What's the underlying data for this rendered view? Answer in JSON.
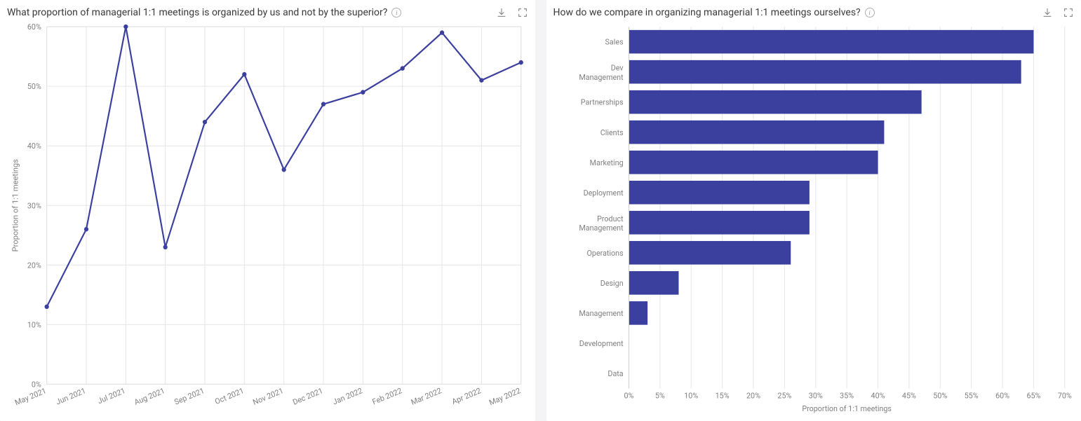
{
  "colors": {
    "series": "#3b3f9e"
  },
  "left_panel": {
    "title": "What proportion of managerial 1:1 meetings is organized by us and not by the superior?",
    "y_axis_label": "Proportion of 1:1 meetings",
    "tooltip": "i"
  },
  "right_panel": {
    "title": "How do we compare in organizing managerial 1:1 meetings ourselves?",
    "x_axis_label": "Proportion of 1:1 meetings",
    "tooltip": "i"
  },
  "chart_data": [
    {
      "id": "proportion_over_time",
      "type": "line",
      "categories": [
        "May 2021",
        "Jun 2021",
        "Jul 2021",
        "Aug 2021",
        "Sep 2021",
        "Oct 2021",
        "Nov 2021",
        "Dec 2021",
        "Jan 2022",
        "Feb 2022",
        "Mar 2022",
        "Apr 2022",
        "May 2022"
      ],
      "values": [
        13,
        26,
        60,
        23,
        44,
        52,
        36,
        47,
        49,
        53,
        59,
        51,
        54
      ],
      "title": "What proportion of managerial 1:1 meetings is organized by us and not by the superior?",
      "xlabel": "",
      "ylabel": "Proportion of 1:1 meetings",
      "ylim": [
        0,
        60
      ],
      "yticks": [
        0,
        10,
        20,
        30,
        40,
        50,
        60
      ],
      "y_suffix": "%"
    },
    {
      "id": "proportion_by_team",
      "type": "bar",
      "orientation": "horizontal",
      "categories": [
        "Sales",
        "Dev Management",
        "Partnerships",
        "Clients",
        "Marketing",
        "Deployment",
        "Product Management",
        "Operations",
        "Design",
        "Management",
        "Development",
        "Data"
      ],
      "values": [
        65,
        63,
        47,
        41,
        40,
        29,
        29,
        26,
        8,
        3,
        0,
        0
      ],
      "title": "How do we compare in organizing managerial 1:1 meetings ourselves?",
      "xlabel": "Proportion of 1:1 meetings",
      "ylabel": "",
      "xlim": [
        0,
        70
      ],
      "xticks": [
        0,
        5,
        10,
        15,
        20,
        25,
        30,
        35,
        40,
        45,
        50,
        55,
        60,
        65,
        70
      ],
      "x_suffix": "%"
    }
  ]
}
